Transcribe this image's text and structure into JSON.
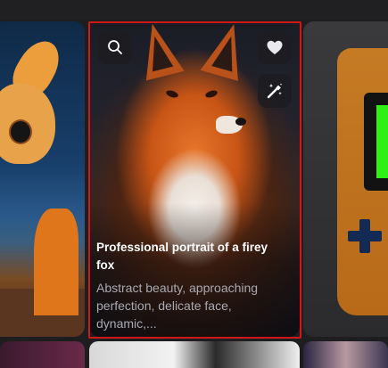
{
  "gallery": {
    "cards": [
      {
        "image_subject": "cartoon creature in desert landscape",
        "interactable": true
      },
      {
        "image_subject": "fox portrait",
        "title": "Professional portrait of a firey fox",
        "description": "Abstract beauty, approaching perfection, delicate face, dynamic,..."
      },
      {
        "image_subject": "orange handheld game console"
      }
    ],
    "actions": {
      "search_icon": "search-icon",
      "favorite_icon": "heart-icon",
      "remix_icon": "magic-wand-icon"
    },
    "colors": {
      "selection_outline": "#d01818",
      "title_text": "#ffffff",
      "description_text": "#a9a9b2",
      "button_bg": "#1c1c20",
      "page_bg": "#1e1e20"
    }
  }
}
